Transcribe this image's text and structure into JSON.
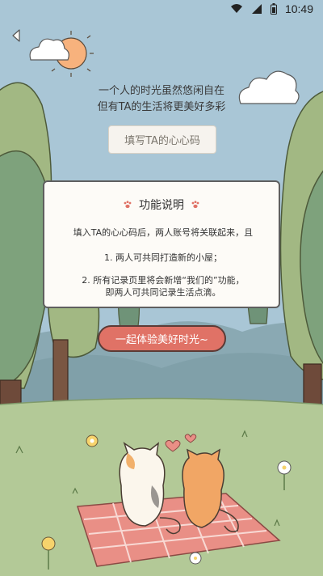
{
  "status_bar": {
    "time": "10:49",
    "icons": [
      "wifi-icon",
      "signal-icon",
      "battery-icon"
    ]
  },
  "navigation": {
    "back_icon": "back-arrow-icon"
  },
  "tagline": {
    "line1": "一个人的时光虽然悠闲自在",
    "line2": "但有TA的生活将更美好多彩"
  },
  "code_button": {
    "label": "填写TA的心心码"
  },
  "feature_modal": {
    "title": "功能说明",
    "intro": "填入TA的心心码后，两人账号将关联起来，且",
    "point1": "1. 两人可共同打造新的小屋；",
    "point2_line1": "2. 所有记录页里将会新增“我们的”功能，",
    "point2_line2": "即两人可共同记录生活点滴。"
  },
  "cta_button": {
    "label": "一起体验美好时光~"
  },
  "colors": {
    "sky": "#a9c6d6",
    "cta": "#e07266",
    "sun": "#f7b27d",
    "grass": "#b3c997",
    "picnic_blanket": "#e98f86"
  }
}
